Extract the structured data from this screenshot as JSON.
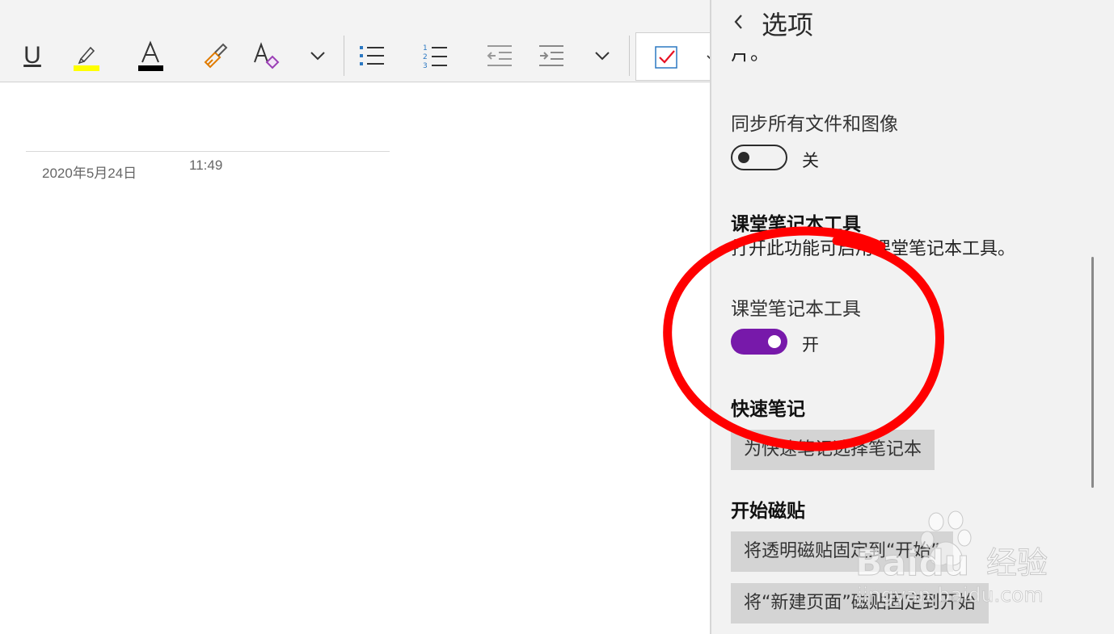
{
  "toolbar": {
    "underline_glyph": "U",
    "font_color_glyph": "A",
    "clear_format_glyph": "A",
    "highlight_color": "#ffff00",
    "font_color": "#000000",
    "accent_purple": "#7719aa",
    "list_accent_blue": "#2b78c2",
    "check_red": "#e81123"
  },
  "page": {
    "date": "2020年5月24日",
    "time": "11:49"
  },
  "options": {
    "title": "选项",
    "cut_off_text": "片。",
    "sync": {
      "label": "同步所有文件和图像",
      "state_label": "关",
      "on": false
    },
    "class_tools": {
      "heading": "课堂笔记本工具",
      "description": "打开此功能可启用课堂笔记本工具。",
      "label": "课堂笔记本工具",
      "state_label": "开",
      "on": true
    },
    "quick_notes": {
      "heading": "快速笔记",
      "button": "为快速笔记选择笔记本"
    },
    "start_tiles": {
      "heading": "开始磁贴",
      "button1": "将透明磁贴固定到“开始”",
      "button2": "将“新建页面”磁贴固定到开始"
    }
  },
  "watermark": {
    "brand": "Baidu",
    "suffix": "经验",
    "url": "jingyan.baidu.com"
  },
  "annotation_color": "#ff0000"
}
